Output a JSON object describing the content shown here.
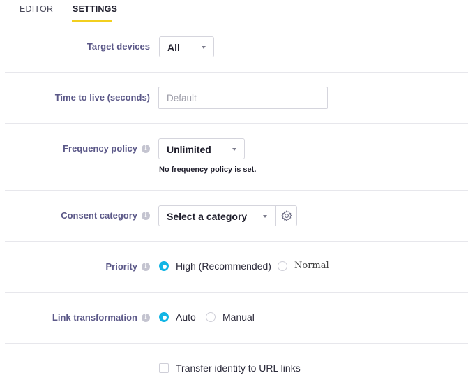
{
  "tabs": [
    {
      "label": "EDITOR",
      "active": false
    },
    {
      "label": "SETTINGS",
      "active": true
    }
  ],
  "accent_color": "#f2cf1f",
  "radio_color": "#12b5e5",
  "settings": {
    "target_devices": {
      "label": "Target devices",
      "value": "All"
    },
    "time_to_live": {
      "label": "Time to live (seconds)",
      "placeholder": "Default",
      "value": ""
    },
    "frequency_policy": {
      "label": "Frequency policy",
      "value": "Unlimited",
      "helper": "No frequency policy is set.",
      "icon": "info-icon"
    },
    "consent_category": {
      "label": "Consent category",
      "value": "Select a category",
      "icon": "info-icon",
      "button_icon": "gear-icon"
    },
    "priority": {
      "label": "Priority",
      "icon": "info-icon",
      "options": [
        {
          "label": "High (Recommended)",
          "selected": true
        },
        {
          "label": "Normal",
          "selected": false
        }
      ]
    },
    "link_transformation": {
      "label": "Link transformation",
      "icon": "info-icon",
      "options": [
        {
          "label": "Auto",
          "selected": true
        },
        {
          "label": "Manual",
          "selected": false
        }
      ]
    },
    "transfer_identity": {
      "label": "Transfer identity to URL links",
      "checked": false
    }
  }
}
